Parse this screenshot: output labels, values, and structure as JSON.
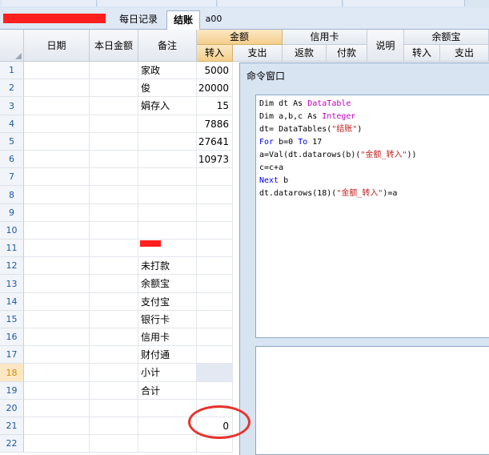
{
  "tabs": [
    {
      "label": "每日记录"
    },
    {
      "label": "结账",
      "active": true
    },
    {
      "label": "a00"
    }
  ],
  "columns": {
    "date": "日期",
    "daily_amount": "本日金额",
    "remark": "备注",
    "amount_group": "金额",
    "amount_in": "转入",
    "amount_out": "支出",
    "credit_group": "信用卡",
    "credit_refund": "返款",
    "credit_pay": "付款",
    "note": "说明",
    "yeb_group": "余额宝",
    "yeb_in": "转入",
    "yeb_out": "支出"
  },
  "rows": [
    {
      "n": "1",
      "remark": "家政",
      "in": "5000"
    },
    {
      "n": "2",
      "remark": "俊",
      "in": "20000"
    },
    {
      "n": "3",
      "remark": "娟存入",
      "in": "15"
    },
    {
      "n": "4",
      "remark": "",
      "in": "7886"
    },
    {
      "n": "5",
      "remark": "",
      "in": "27641"
    },
    {
      "n": "6",
      "remark": "",
      "in": "10973"
    },
    {
      "n": "7",
      "remark": "",
      "in": ""
    },
    {
      "n": "8",
      "remark": "",
      "in": ""
    },
    {
      "n": "9",
      "remark": "",
      "in": ""
    },
    {
      "n": "10",
      "remark": "",
      "in": ""
    },
    {
      "n": "11",
      "remark": "",
      "in": ""
    },
    {
      "n": "12",
      "remark": "未打款",
      "in": ""
    },
    {
      "n": "13",
      "remark": "余额宝",
      "in": ""
    },
    {
      "n": "14",
      "remark": "支付宝",
      "in": ""
    },
    {
      "n": "15",
      "remark": "银行卡",
      "in": ""
    },
    {
      "n": "16",
      "remark": "信用卡",
      "in": ""
    },
    {
      "n": "17",
      "remark": "财付通",
      "in": ""
    },
    {
      "n": "18",
      "remark": "小计",
      "in": ""
    },
    {
      "n": "19",
      "remark": "合计",
      "in": ""
    },
    {
      "n": "20",
      "remark": "",
      "in": ""
    },
    {
      "n": "21",
      "remark": "",
      "in": "0"
    },
    {
      "n": "22",
      "remark": "",
      "in": ""
    }
  ],
  "selected_row": "18",
  "command_window": {
    "title": "命令窗口",
    "code_lines": [
      [
        {
          "t": "Dim dt As ",
          "c": "plain"
        },
        {
          "t": "DataTable",
          "c": "ty"
        }
      ],
      [
        {
          "t": "Dim a,b,c As ",
          "c": "plain"
        },
        {
          "t": "Integer",
          "c": "ty"
        }
      ],
      [
        {
          "t": "dt= DataTables(",
          "c": "plain"
        },
        {
          "t": "\"结账\"",
          "c": "st"
        },
        {
          "t": ")",
          "c": "plain"
        }
      ],
      [
        {
          "t": "For ",
          "c": "kw"
        },
        {
          "t": "b=0 ",
          "c": "plain"
        },
        {
          "t": "To ",
          "c": "kw"
        },
        {
          "t": "17",
          "c": "plain"
        }
      ],
      [
        {
          "t": "a=Val(dt.datarows(b)(",
          "c": "plain"
        },
        {
          "t": "\"金额_转入\"",
          "c": "st"
        },
        {
          "t": "))",
          "c": "plain"
        }
      ],
      [
        {
          "t": "c=c+a",
          "c": "plain"
        }
      ],
      [
        {
          "t": "Next ",
          "c": "kw"
        },
        {
          "t": "b",
          "c": "plain"
        }
      ],
      [
        {
          "t": "dt.datarows(18)(",
          "c": "plain"
        },
        {
          "t": "\"金额_转入\"",
          "c": "st"
        },
        {
          "t": ")=a",
          "c": "plain"
        }
      ]
    ]
  },
  "colors": {
    "annotation": "#e8322b",
    "redaction": "#ff1f1f"
  }
}
